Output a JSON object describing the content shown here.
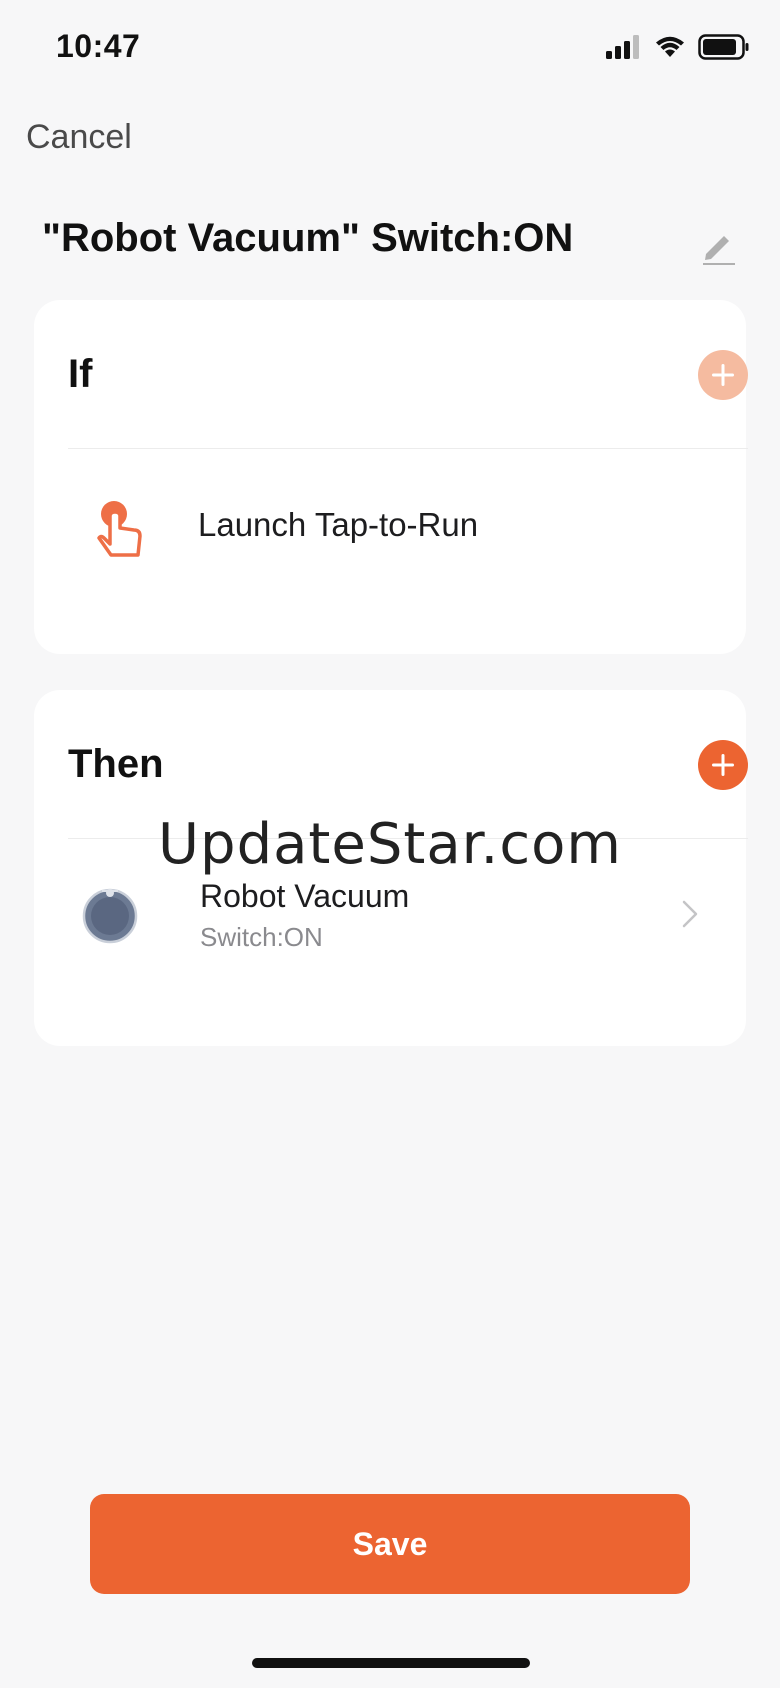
{
  "status_bar": {
    "time": "10:47",
    "signal_icon": "cellular-signal-icon",
    "wifi_icon": "wifi-icon",
    "battery_icon": "battery-icon"
  },
  "nav": {
    "cancel_label": "Cancel"
  },
  "scene": {
    "title": "\"Robot Vacuum\" Switch:ON",
    "edit_icon": "pencil-icon"
  },
  "if_section": {
    "title": "If",
    "add_icon": "plus-icon",
    "condition": {
      "icon": "tap-hand-icon",
      "label": "Launch Tap-to-Run"
    }
  },
  "then_section": {
    "title": "Then",
    "add_icon": "plus-icon",
    "action": {
      "icon": "robot-vacuum-icon",
      "name": "Robot Vacuum",
      "detail": "Switch:ON",
      "chevron_icon": "chevron-right-icon"
    }
  },
  "watermark": "UpdateStar.com",
  "footer": {
    "save_label": "Save"
  },
  "colors": {
    "accent": "#ec6431",
    "accent_faded": "#f5bba0",
    "background": "#f7f7f8",
    "card": "#ffffff"
  }
}
